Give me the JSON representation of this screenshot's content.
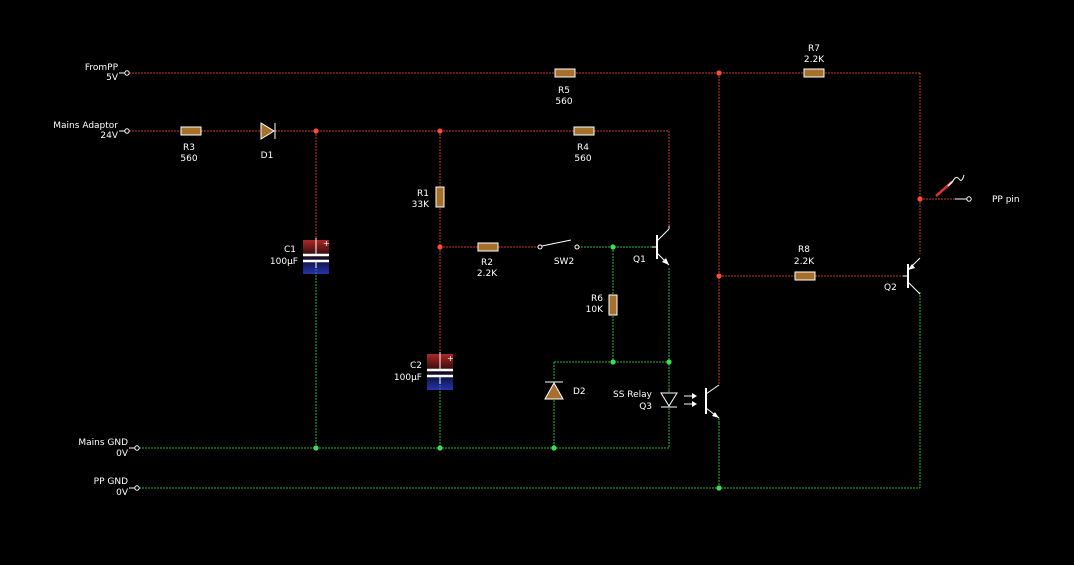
{
  "colors": {
    "background": "#000000",
    "wire_high": "#c83a2a",
    "wire_gnd": "#28b84a",
    "component": "#a6702a",
    "text": "#ffffff"
  },
  "terminals": {
    "from_pp": {
      "name": "FromPP",
      "voltage": "5V"
    },
    "mains_adaptor": {
      "name": "Mains Adaptor",
      "voltage": "24V"
    },
    "mains_gnd": {
      "name": "Mains GND",
      "voltage": "0V"
    },
    "pp_gnd": {
      "name": "PP GND",
      "voltage": "0V"
    },
    "pp_pin": {
      "name": "PP pin"
    }
  },
  "components": {
    "r1": {
      "ref": "R1",
      "value": "33K"
    },
    "r2": {
      "ref": "R2",
      "value": "2.2K"
    },
    "r3": {
      "ref": "R3",
      "value": "560"
    },
    "r4": {
      "ref": "R4",
      "value": "560"
    },
    "r5": {
      "ref": "R5",
      "value": "560"
    },
    "r6": {
      "ref": "R6",
      "value": "10K"
    },
    "r7": {
      "ref": "R7",
      "value": "2.2K"
    },
    "r8": {
      "ref": "R8",
      "value": "2.2K"
    },
    "c1": {
      "ref": "C1",
      "value": "100µF"
    },
    "c2": {
      "ref": "C2",
      "value": "100µF"
    },
    "d1": {
      "ref": "D1"
    },
    "d2": {
      "ref": "D2"
    },
    "sw2": {
      "ref": "SW2"
    },
    "q1": {
      "ref": "Q1"
    },
    "q2": {
      "ref": "Q2"
    },
    "q3": {
      "ref": "Q3",
      "label": "SS Relay"
    }
  }
}
